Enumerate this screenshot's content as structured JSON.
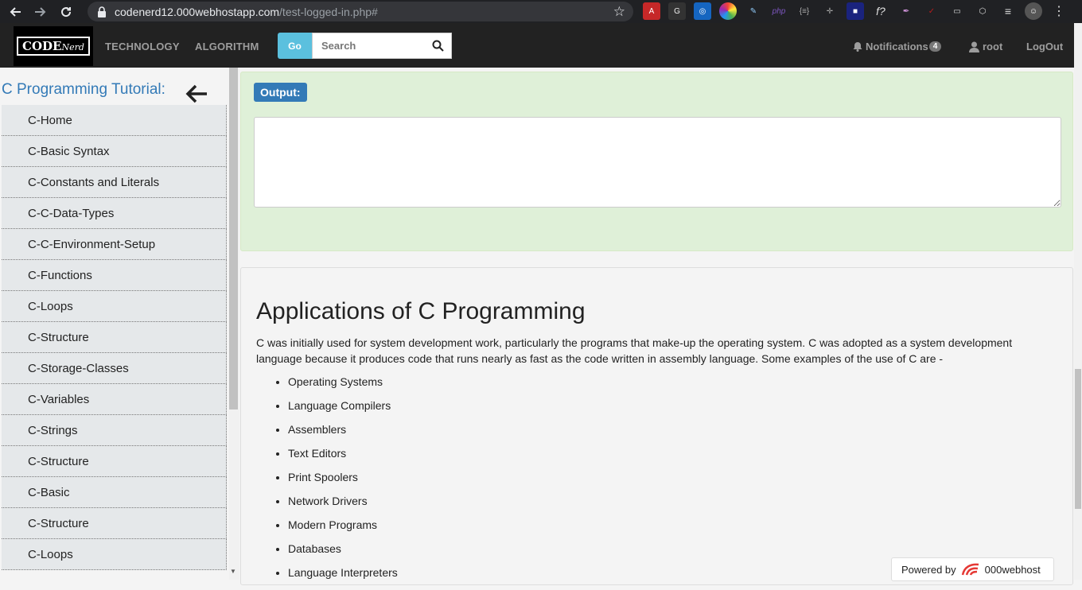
{
  "browser": {
    "url_host": "codenerd12.000webhostapp.com",
    "url_path": "/test-logged-in.php#"
  },
  "navbar": {
    "logo_text": "CODE",
    "logo_script": "Nerd",
    "links": [
      "TECHNOLOGY",
      "ALGORITHM"
    ],
    "go_label": "Go",
    "search_placeholder": "Search",
    "notifications_label": "Notifications",
    "notifications_count": "4",
    "user_label": "root",
    "logout_label": "LogOut"
  },
  "sidebar": {
    "title": "C Programming Tutorial:",
    "items": [
      "C-Home",
      "C-Basic Syntax",
      "C-Constants and Literals",
      "C-C-Data-Types",
      "C-C-Environment-Setup",
      "C-Functions",
      "C-Loops",
      "C-Structure",
      "C-Storage-Classes",
      "C-Variables",
      "C-Strings",
      "C-Structure",
      "C-Basic",
      "C-Structure",
      "C-Loops"
    ]
  },
  "output": {
    "label": "Output:",
    "value": ""
  },
  "article": {
    "heading": "Applications of C Programming",
    "paragraph": "C was initially used for system development work, particularly the programs that make-up the operating system. C was adopted as a system development language because it produces code that runs nearly as fast as the code written in assembly language. Some examples of the use of C are -",
    "list": [
      "Operating Systems",
      "Language Compilers",
      "Assemblers",
      "Text Editors",
      "Print Spoolers",
      "Network Drivers",
      "Modern Programs",
      "Databases",
      "Language Interpreters"
    ]
  },
  "footer_badge": {
    "prefix": "Powered by",
    "brand": "000webhost"
  },
  "colors": {
    "navbar_bg": "#222222",
    "accent_blue": "#337ab7",
    "go_button": "#5bc0de",
    "output_panel_bg": "#dff0d8"
  }
}
